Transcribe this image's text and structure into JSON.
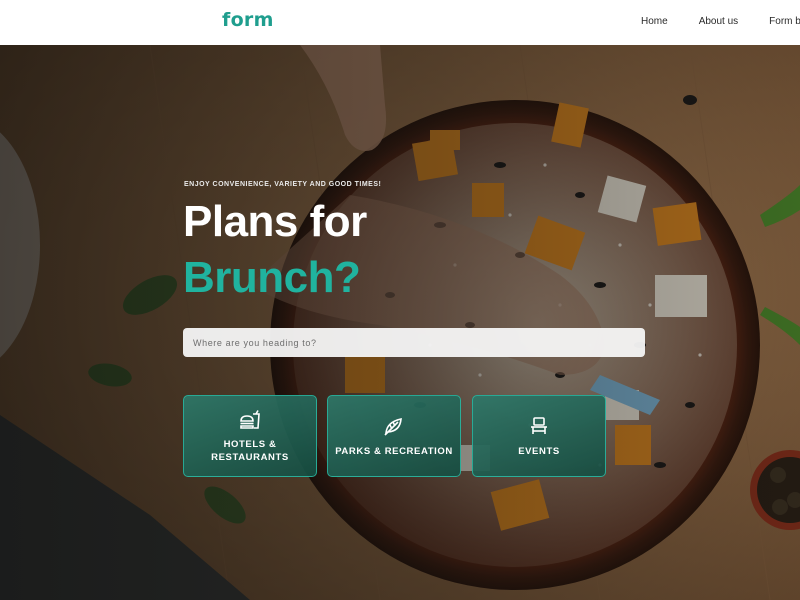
{
  "header": {
    "logo": "form",
    "nav": [
      {
        "label": "Home"
      },
      {
        "label": "About us"
      },
      {
        "label": "Form by"
      }
    ]
  },
  "hero": {
    "eyebrow": "ENJOY CONVENIENCE, VARIETY AND GOOD TIMES!",
    "headline_line1": "Plans for",
    "headline_line2": "Brunch?",
    "search_placeholder": "Where are you heading to?",
    "categories": [
      {
        "label_line1": "HOTELS &",
        "label_line2": "RESTAURANTS",
        "icon": "burger-drink-icon"
      },
      {
        "label_line1": "PARKS & RECREATION",
        "label_line2": "",
        "icon": "leaf-icon"
      },
      {
        "label_line1": "EVENTS",
        "label_line2": "",
        "icon": "chair-icon"
      }
    ]
  },
  "colors": {
    "accent": "#20b39f",
    "logo": "#1f9e8e",
    "card_bg": "#1f5e52",
    "card_border": "#2bbea8"
  }
}
